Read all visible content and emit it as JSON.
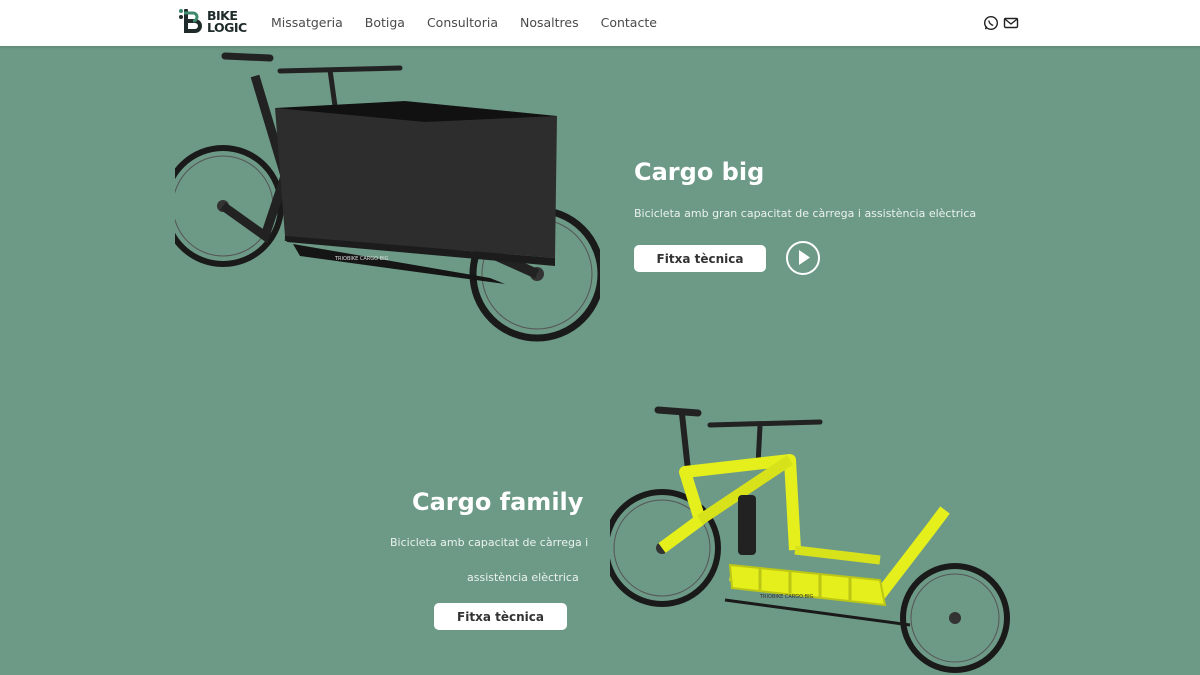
{
  "header": {
    "logo": {
      "line1": "BIKE",
      "line2": "LOGIC"
    },
    "nav": [
      "Missatgeria",
      "Botiga",
      "Consultoria",
      "Nosaltres",
      "Contacte"
    ],
    "icons": [
      "whatsapp-icon",
      "mail-icon"
    ]
  },
  "sections": [
    {
      "title": "Cargo big",
      "description": "Bicicleta amb gran capacitat de càrrega i assistència elèctrica",
      "button": "Fitxa tècnica",
      "bike_label": "TRIOBIKE CARGO BIG"
    },
    {
      "title": "Cargo family",
      "description_line1": "Bicicleta amb capacitat de càrrega i",
      "description_line2": "assistència elèctrica",
      "button": "Fitxa tècnica",
      "bike_label": "TRIOBIKE CARGO BIG"
    }
  ],
  "colors": {
    "background": "#6d9a86",
    "header": "#ffffff",
    "accent_yellow": "#e4ef1c",
    "dark_bike": "#2a2a2a"
  }
}
